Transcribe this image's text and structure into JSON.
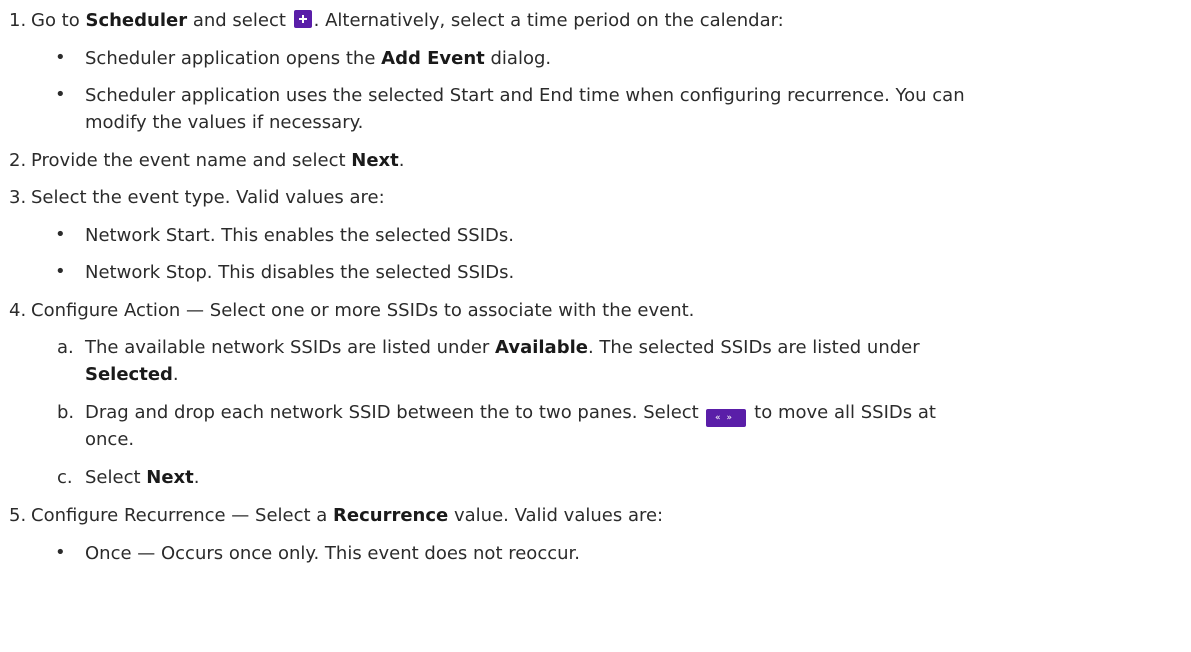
{
  "steps": {
    "s1": {
      "num": "1.",
      "a": "Go to ",
      "b": "Scheduler",
      "c": " and select ",
      "d": ". Alternatively, select a time period on the calendar:",
      "bullets": {
        "b1a": "Scheduler application opens the ",
        "b1b": "Add Event",
        "b1c": " dialog.",
        "b2a": "Scheduler application uses the selected Start and End time when configuring recurrence. You can",
        "b2b": "modify the values if necessary."
      }
    },
    "s2": {
      "num": "2.",
      "a": "Provide the event name and select ",
      "b": "Next",
      "c": "."
    },
    "s3": {
      "num": "3.",
      "a": "Select the event type. Valid values are:",
      "bullets": {
        "b1": "Network Start. This enables the selected SSIDs.",
        "b2": "Network Stop. This disables the selected SSIDs."
      }
    },
    "s4": {
      "num": "4.",
      "a": "Configure Action — Select one or more SSIDs to associate with the event.",
      "subs": {
        "a_label": "a.",
        "a1": "The available network SSIDs are listed under ",
        "a2": "Available",
        "a3": ". The selected SSIDs are listed under",
        "a4": "Selected",
        "a5": ".",
        "b_label": "b.",
        "b1": "Drag and drop each network SSID between the to two panes. Select ",
        "b2": " to move all SSIDs at",
        "b3": "once.",
        "c_label": "c.",
        "c1": "Select ",
        "c2": "Next",
        "c3": "."
      }
    },
    "s5": {
      "num": "5.",
      "a": "Configure Recurrence — Select a ",
      "b": "Recurrence",
      "c": " value. Valid values are:",
      "bullets": {
        "b1": "Once — Occurs once only. This event does not reoccur."
      }
    }
  },
  "icons": {
    "add": "plus-square-icon",
    "move_all": "double-arrow-icon",
    "move_glyph": "«»"
  },
  "colors": {
    "accent": "#5a1ea8",
    "text": "#2b2b2b"
  }
}
